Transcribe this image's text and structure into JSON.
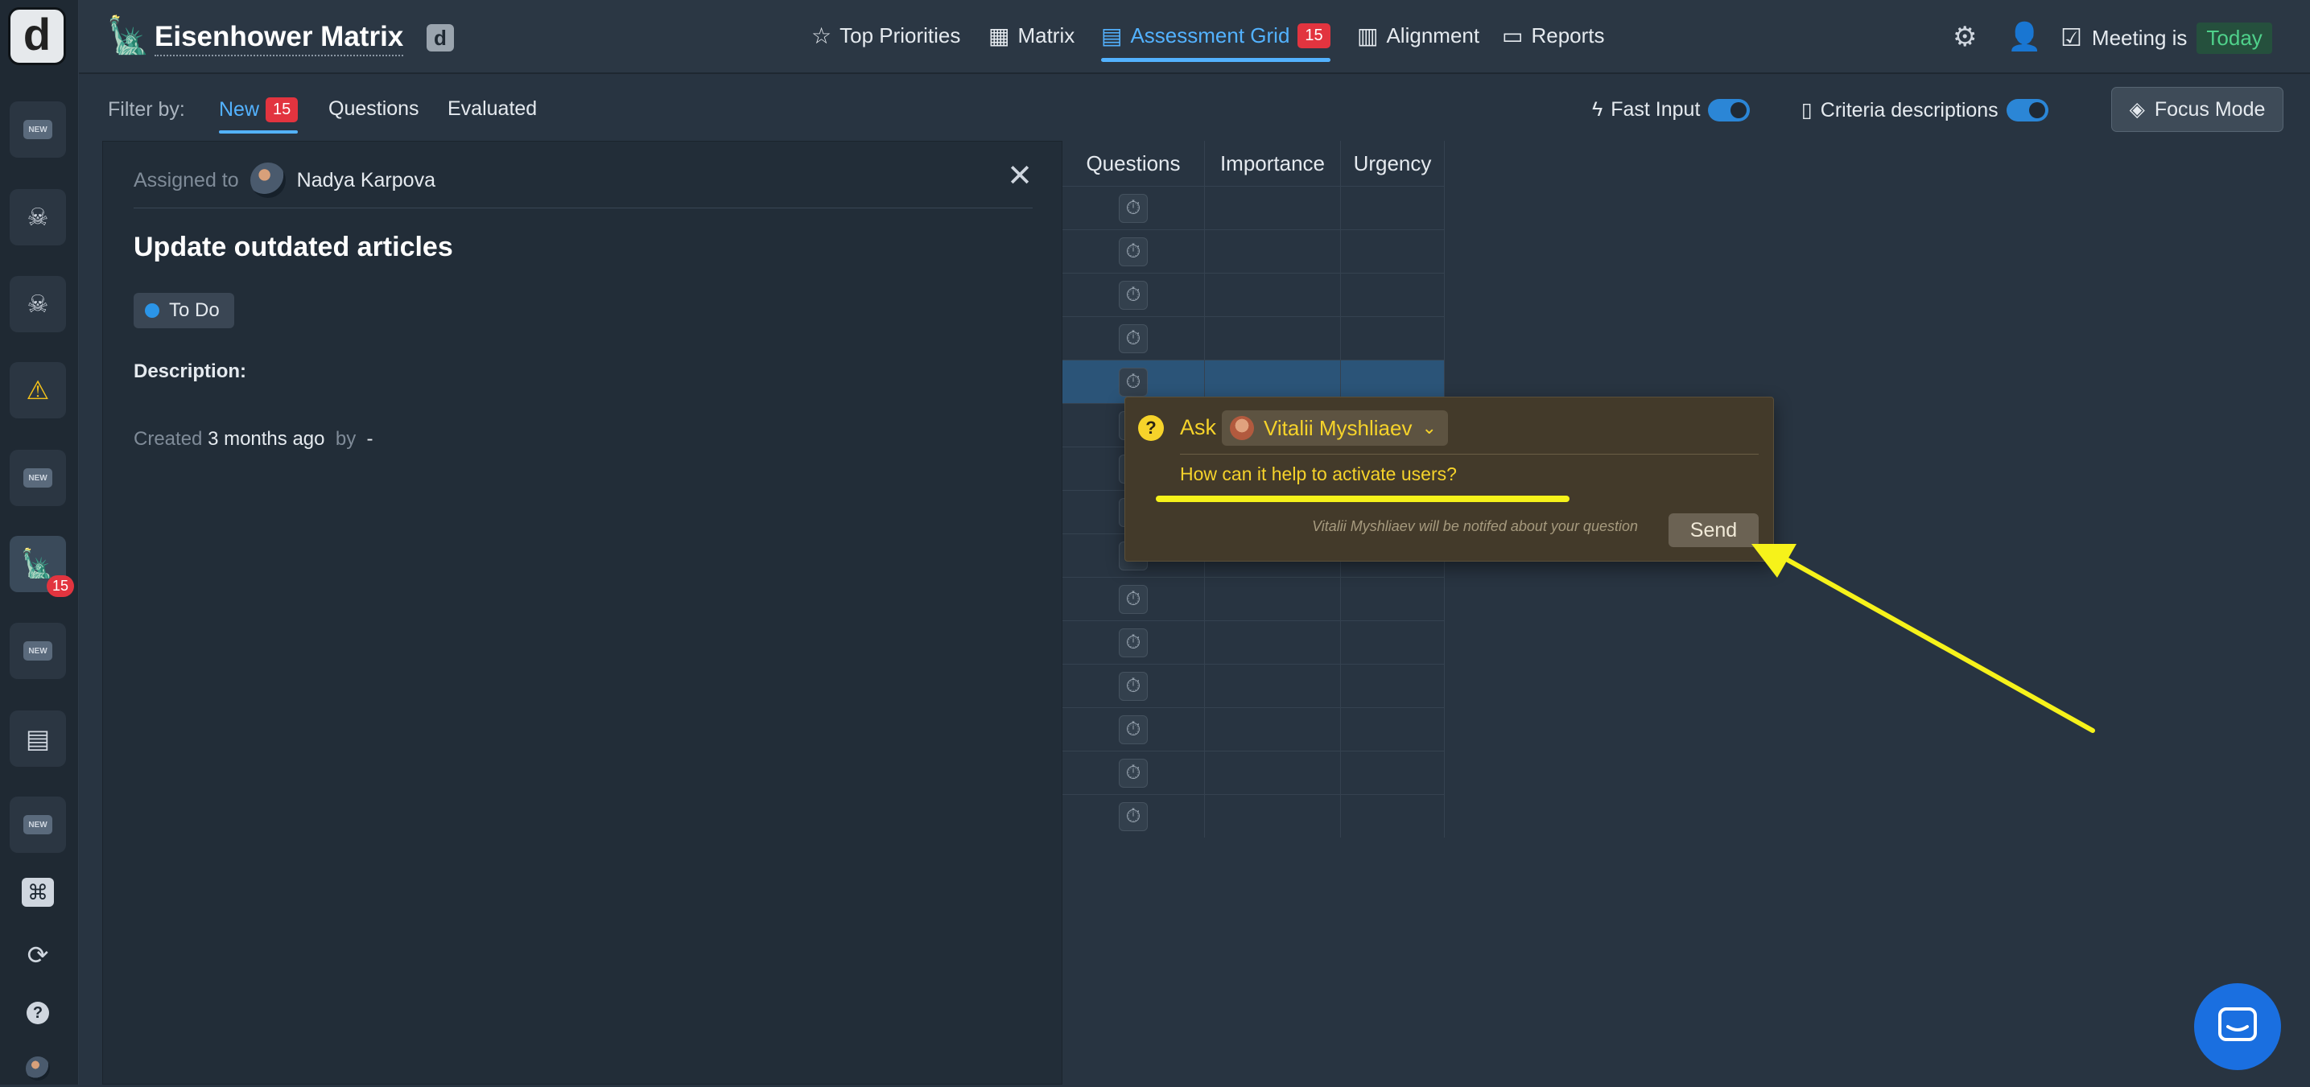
{
  "rail": {
    "logo": "d",
    "new_label": "NEW",
    "badge": "15"
  },
  "header": {
    "title": "Eisenhower Matrix",
    "chip": "d",
    "nav": [
      {
        "label": "Top Priorities",
        "icon": "star-icon"
      },
      {
        "label": "Matrix",
        "icon": "grid-icon"
      },
      {
        "label": "Assessment Grid",
        "icon": "list-icon",
        "badge": "15"
      },
      {
        "label": "Alignment",
        "icon": "bars-icon"
      },
      {
        "label": "Reports",
        "icon": "report-icon"
      }
    ],
    "meeting_label": "Meeting is",
    "meeting_value": "Today"
  },
  "filter": {
    "label": "Filter by:",
    "tabs": [
      {
        "label": "New",
        "badge": "15"
      },
      {
        "label": "Questions"
      },
      {
        "label": "Evaluated"
      }
    ],
    "fast_input": "Fast Input",
    "criteria": "Criteria descriptions",
    "focus_mode": "Focus Mode"
  },
  "panel": {
    "assigned_label": "Assigned to",
    "assignee": "Nadya Karpova",
    "title": "Update outdated articles",
    "status": "To Do",
    "description_label": "Description:",
    "created_label": "Created",
    "created_value": "3 months ago",
    "by_label": "by",
    "by_value": "-"
  },
  "grid": {
    "headers": [
      "Questions",
      "Importance",
      "Urgency"
    ]
  },
  "ask": {
    "label": "Ask",
    "user": "Vitalii Myshliaev",
    "input_value": "How can it help to activate users?",
    "note": "Vitalii Myshliaev will be notifed about your question",
    "send": "Send"
  },
  "colors": {
    "accent": "#53b2ff",
    "badge": "#e2343f",
    "highlight": "#f6f21a"
  }
}
